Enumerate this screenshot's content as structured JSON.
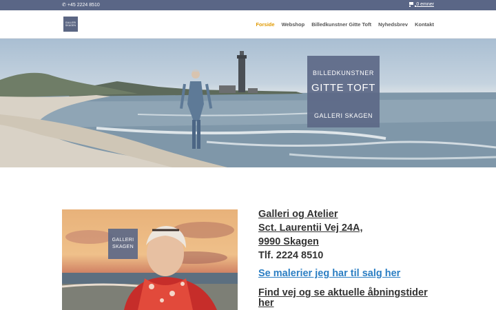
{
  "topbar": {
    "phone": "+45 2224 8510",
    "cart": "0 emner"
  },
  "header": {
    "logo": {
      "line1": "GALLERI",
      "line2": "SKAGEN"
    },
    "nav": [
      "Forside",
      "Webshop",
      "Billedkunstner Gitte Toft",
      "Nyhedsbrev",
      "Kontakt"
    ],
    "active_nav": "Forside",
    "accent_color": "#e09900"
  },
  "hero": {
    "box": {
      "line1": "BILLEDKUNSTNER",
      "line2": "GITTE TOFT",
      "line3": "GALLERI SKAGEN"
    }
  },
  "content": {
    "photo_box": {
      "line1": "GALLERI",
      "line2": "SKAGEN"
    },
    "address": {
      "line1": "Galleri og Atelier",
      "line2": "Sct. Laurentii Vej 24A,",
      "line3": "9990 Skagen",
      "line4": "Tlf. 2224 8510"
    },
    "sale_link": "Se malerier jeg har til salg her",
    "find_link": "Find vej og se aktuelle åbningstider her",
    "link_color": "#2b7ec3"
  }
}
